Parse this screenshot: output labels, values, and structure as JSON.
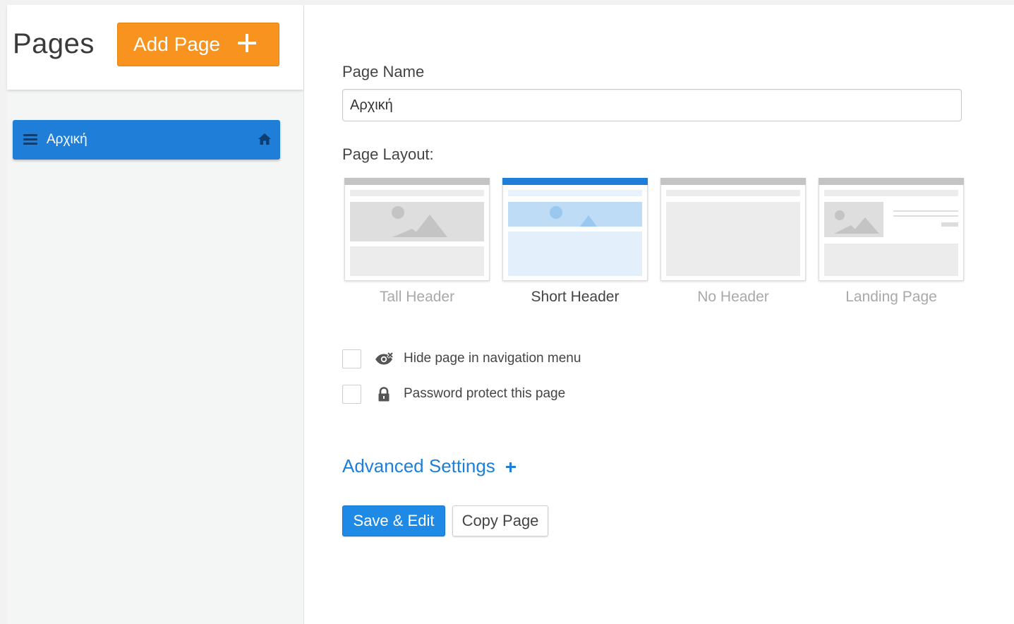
{
  "sidebar": {
    "title": "Pages",
    "add_page_label": "Add Page",
    "items": [
      {
        "label": "Αρχική",
        "is_home": true,
        "selected": true
      }
    ]
  },
  "form": {
    "page_name_label": "Page Name",
    "page_name_value": "Αρχική",
    "layout_label": "Page Layout:",
    "layouts": [
      {
        "label": "Tall Header",
        "selected": false
      },
      {
        "label": "Short Header",
        "selected": true
      },
      {
        "label": "No Header",
        "selected": false
      },
      {
        "label": "Landing Page",
        "selected": false
      }
    ],
    "options": [
      {
        "label": "Hide page in navigation menu",
        "icon": "eye-slash-icon",
        "checked": false
      },
      {
        "label": "Password protect this page",
        "icon": "lock-icon",
        "checked": false
      }
    ],
    "advanced_settings_label": "Advanced Settings",
    "save_label": "Save & Edit",
    "copy_label": "Copy Page"
  },
  "colors": {
    "accent_blue": "#1f7fd8",
    "add_button_orange": "#f7931e",
    "sidebar_bg": "#f4f5f5"
  }
}
